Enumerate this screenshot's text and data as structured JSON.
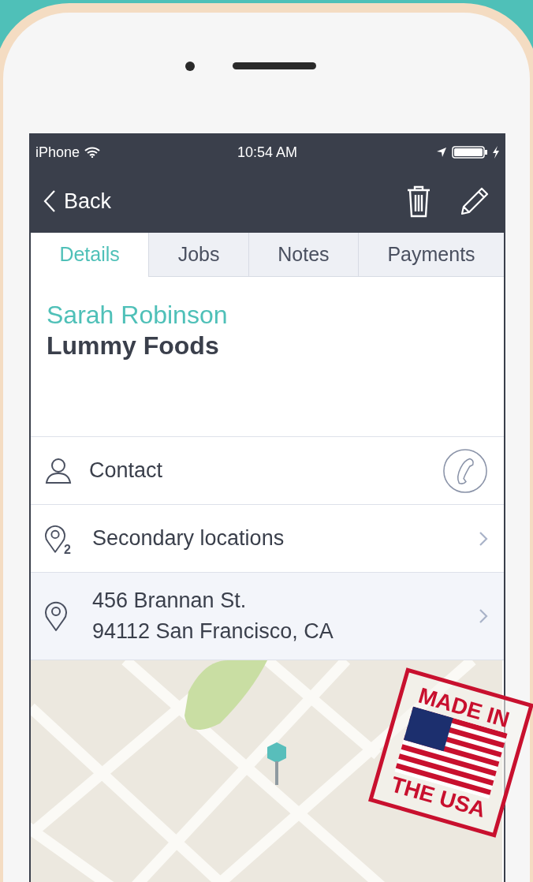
{
  "status_bar": {
    "carrier": "iPhone",
    "time": "10:54 AM"
  },
  "nav": {
    "back": "Back"
  },
  "tabs": [
    {
      "label": "Details",
      "selected": true
    },
    {
      "label": "Jobs",
      "selected": false
    },
    {
      "label": "Notes",
      "selected": false
    },
    {
      "label": "Payments",
      "selected": false
    }
  ],
  "customer": {
    "name": "Sarah Robinson",
    "company": "Lummy Foods"
  },
  "rows": [
    {
      "kind": "contact",
      "label": "Contact"
    },
    {
      "kind": "locations",
      "label": "Secondary locations",
      "badge": "2"
    },
    {
      "kind": "address",
      "lines": [
        "456 Brannan St.",
        "94112 San Francisco, CA"
      ]
    }
  ],
  "stamp": {
    "top": "MADE IN",
    "bottom": "THE USA"
  }
}
